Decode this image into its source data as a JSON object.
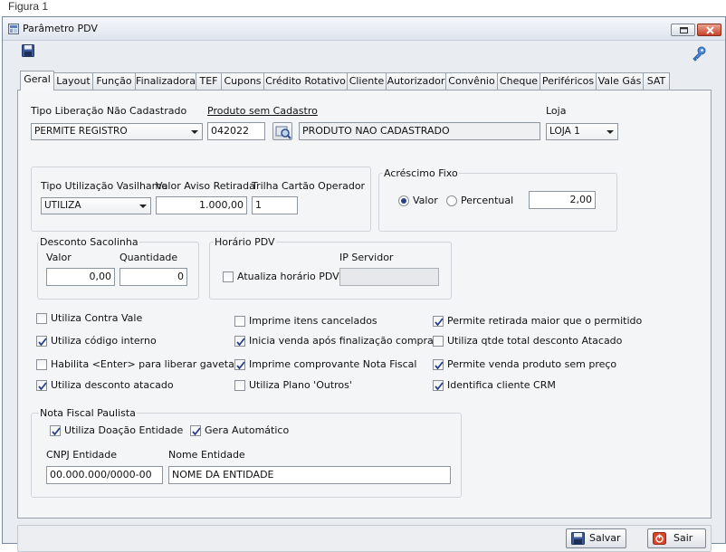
{
  "caption": "Figura 1",
  "window": {
    "title": "Parâmetro PDV"
  },
  "tabs": [
    "Geral",
    "Layout",
    "Função",
    "Finalizadora",
    "TEF",
    "Cupons",
    "Crédito Rotativo",
    "Cliente",
    "Autorizador",
    "Convênio",
    "Cheque",
    "Periféricos",
    "Vale Gás",
    "SAT"
  ],
  "active_tab": "Geral",
  "row1": {
    "tipo_liberacao_label": "Tipo Liberação Não Cadastrado",
    "tipo_liberacao_value": "PERMITE REGISTRO",
    "produto_label": "Produto sem Cadastro",
    "produto_code": "042022",
    "produto_desc": "PRODUTO NAO CADASTRADO",
    "loja_label": "Loja",
    "loja_value": "LOJA 1"
  },
  "vasilhame": {
    "tipo_label": "Tipo Utilização Vasilhame",
    "tipo_value": "UTILIZA",
    "aviso_label": "Valor Aviso Retirada",
    "aviso_value": "1.000,00",
    "trilha_label": "Trilha Cartão Operador",
    "trilha_value": "1"
  },
  "acrescimo": {
    "title": "Acréscimo Fixo",
    "option_valor": "Valor",
    "option_percentual": "Percentual",
    "selected": "Valor",
    "value": "2,00"
  },
  "sacolinha": {
    "title": "Desconto Sacolinha",
    "valor_label": "Valor",
    "valor_value": "0,00",
    "quantidade_label": "Quantidade",
    "quantidade_value": "0"
  },
  "horario": {
    "title": "Horário PDV",
    "atualiza_label": "Atualiza horário PDV",
    "atualiza_checked": false,
    "ip_label": "IP Servidor",
    "ip_value": ""
  },
  "checkboxes": [
    {
      "label": "Utiliza Contra Vale",
      "checked": false
    },
    {
      "label": "Utiliza código interno",
      "checked": true
    },
    {
      "label": "Habilita <Enter> para liberar gaveta",
      "checked": false
    },
    {
      "label": "Utiliza desconto atacado",
      "checked": true
    },
    {
      "label": "Imprime itens cancelados",
      "checked": false
    },
    {
      "label": "Inicia venda após finalização compra",
      "checked": true
    },
    {
      "label": "Imprime comprovante Nota Fiscal",
      "checked": true
    },
    {
      "label": "Utiliza Plano 'Outros'",
      "checked": false
    },
    {
      "label": "Permite retirada maior que o permitido",
      "checked": true
    },
    {
      "label": "Utiliza qtde total desconto Atacado",
      "checked": false
    },
    {
      "label": "Permite venda produto sem preço",
      "checked": true
    },
    {
      "label": "Identifica cliente CRM",
      "checked": true
    }
  ],
  "nota_fiscal": {
    "title": "Nota Fiscal Paulista",
    "doacao_label": "Utiliza Doação Entidade",
    "doacao_checked": true,
    "gera_label": "Gera Automático",
    "gera_checked": true,
    "cnpj_label": "CNPJ Entidade",
    "cnpj_value": "00.000.000/0000-00",
    "nome_label": "Nome Entidade",
    "nome_value": "NOME DA ENTIDADE"
  },
  "buttons": {
    "save": "Salvar",
    "exit": "Sair"
  },
  "colors": {
    "accent": "#253f8c",
    "close_red": "#c8412a",
    "tab_border": "#9aa3ad"
  },
  "icons": [
    "app-icon",
    "floppy-disk-icon",
    "key-icon",
    "search-icon",
    "power-icon"
  ]
}
